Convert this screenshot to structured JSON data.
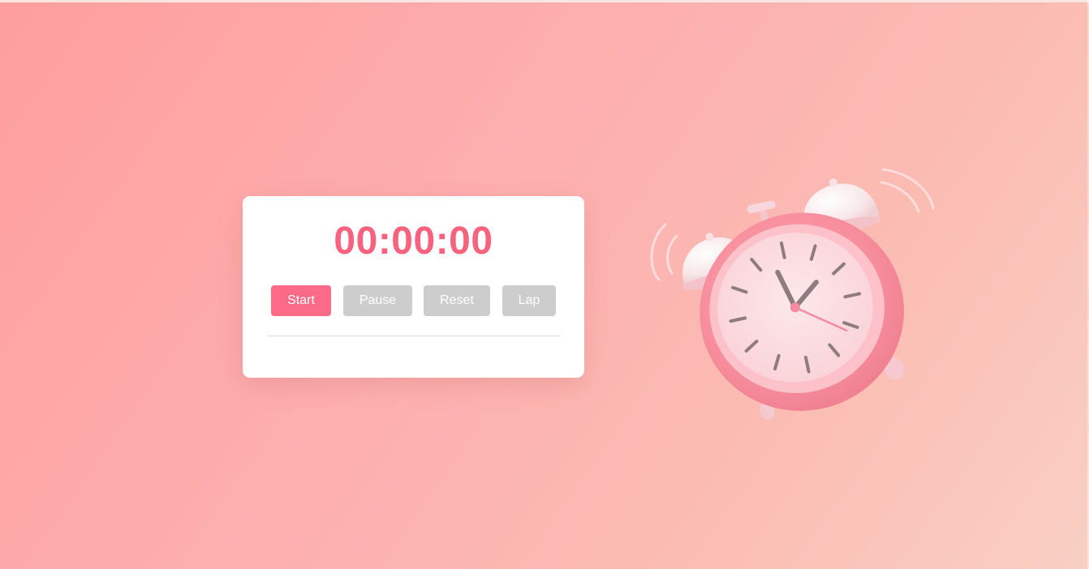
{
  "stopwatch": {
    "display": "00:00:00",
    "buttons": {
      "start": "Start",
      "pause": "Pause",
      "reset": "Reset",
      "lap": "Lap"
    },
    "laps": []
  },
  "colors": {
    "accent": "#f7627f",
    "start_button": "#fb6a87",
    "disabled_button": "#cdcdcd",
    "card_background": "#ffffff",
    "page_gradient_start": "#fe9e9e",
    "page_gradient_end": "#f9d0c3"
  },
  "icons": {
    "illustration": "alarm-clock-icon"
  }
}
